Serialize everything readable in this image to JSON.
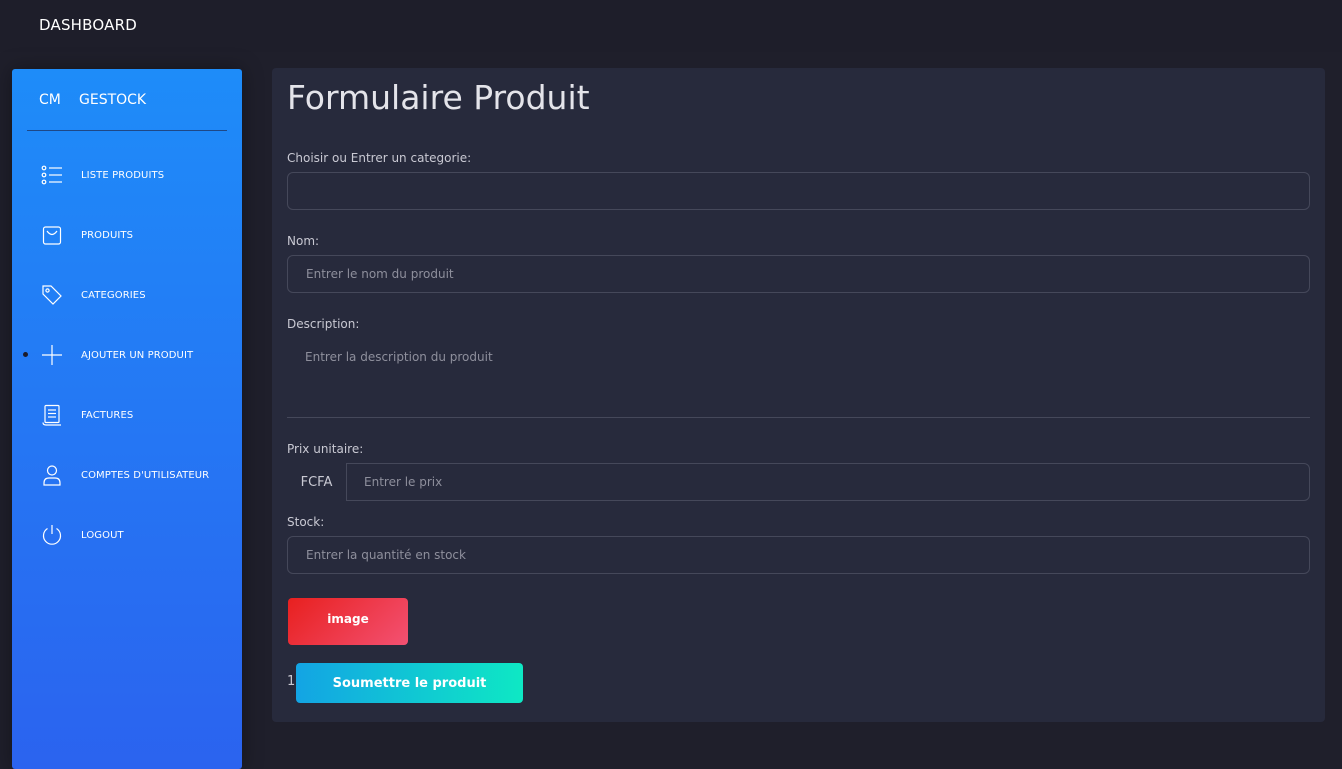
{
  "topbar": {
    "brand": "DASHBOARD"
  },
  "sidebar": {
    "logo_mini": "CM",
    "logo_normal": "GESTOCK",
    "items": [
      {
        "label": "LISTE PRODUITS",
        "icon": "list-icon",
        "active": false
      },
      {
        "label": "PRODUITS",
        "icon": "shopping-bag-icon",
        "active": false
      },
      {
        "label": "CATEGORIES",
        "icon": "tag-icon",
        "active": false
      },
      {
        "label": "AJOUTER UN PRODUIT",
        "icon": "plus-icon",
        "active": true
      },
      {
        "label": "FACTURES",
        "icon": "receipt-icon",
        "active": false
      },
      {
        "label": "COMPTES D'UTILISATEUR",
        "icon": "user-icon",
        "active": false
      },
      {
        "label": "LOGOUT",
        "icon": "power-icon",
        "active": false
      }
    ]
  },
  "form": {
    "title": "Formulaire Produit",
    "category_label": "Choisir ou Entrer un categorie:",
    "category_value": "",
    "name_label": "Nom:",
    "name_placeholder": "Entrer le nom du produit",
    "description_label": "Description:",
    "description_placeholder": "Entrer la description du produit",
    "price_label": "Prix unitaire:",
    "price_prefix": "FCFA",
    "price_placeholder": "Entrer le prix",
    "stock_label": "Stock:",
    "stock_placeholder": "Entrer la quantité en stock",
    "image_button": "image",
    "stray_text": "1",
    "submit_button": "Soumettre le produit"
  },
  "colors": {
    "sidebar_top": "#1e8cf9",
    "sidebar_bottom": "#2b63ef",
    "card_bg": "#272a3c",
    "page_bg": "#1f1f2b",
    "image_button": "#e8201f",
    "submit_button": "#13a4e4"
  }
}
